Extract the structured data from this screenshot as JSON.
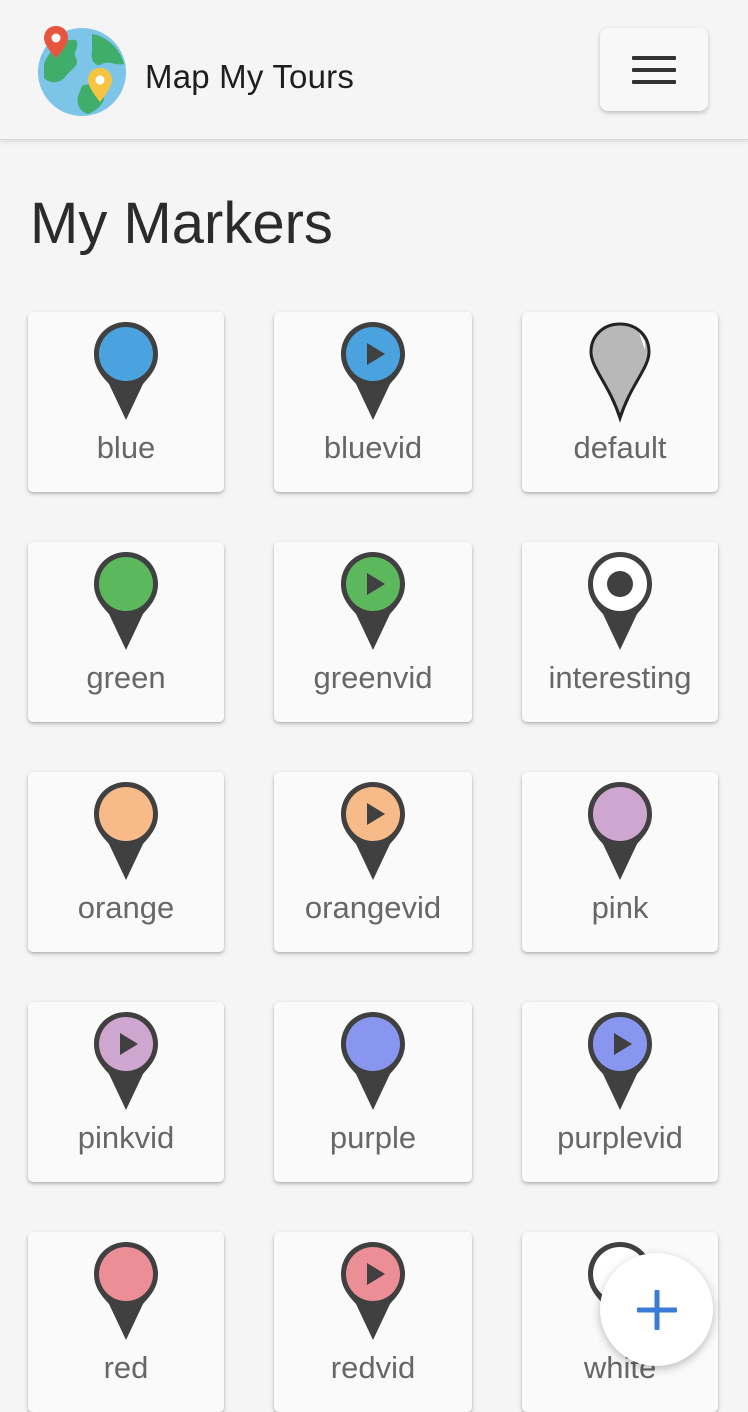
{
  "header": {
    "app_title": "Map My Tours",
    "logo_icon": "globe-with-pins-icon",
    "menu_icon": "hamburger-menu-icon"
  },
  "page": {
    "title": "My Markers"
  },
  "markers": [
    {
      "label": "blue",
      "color": "#4aa3df",
      "style": "dot"
    },
    {
      "label": "bluevid",
      "color": "#4aa3df",
      "style": "play"
    },
    {
      "label": "default",
      "color": "#b8b8b8",
      "style": "default"
    },
    {
      "label": "green",
      "color": "#5cb85c",
      "style": "dot"
    },
    {
      "label": "greenvid",
      "color": "#5cb85c",
      "style": "play"
    },
    {
      "label": "interesting",
      "color": "#ffffff",
      "style": "ring"
    },
    {
      "label": "orange",
      "color": "#f7bb8a",
      "style": "dot"
    },
    {
      "label": "orangevid",
      "color": "#f7bb8a",
      "style": "play"
    },
    {
      "label": "pink",
      "color": "#cfa6cf",
      "style": "dot"
    },
    {
      "label": "pinkvid",
      "color": "#cfa6cf",
      "style": "play"
    },
    {
      "label": "purple",
      "color": "#8896f0",
      "style": "dot"
    },
    {
      "label": "purplevid",
      "color": "#8896f0",
      "style": "play"
    },
    {
      "label": "red",
      "color": "#ec8e96",
      "style": "dot"
    },
    {
      "label": "redvid",
      "color": "#ec8e96",
      "style": "play"
    },
    {
      "label": "white",
      "color": "#ffffff",
      "style": "dot"
    }
  ],
  "fab": {
    "icon": "plus-icon",
    "color": "#3a7bd5"
  }
}
